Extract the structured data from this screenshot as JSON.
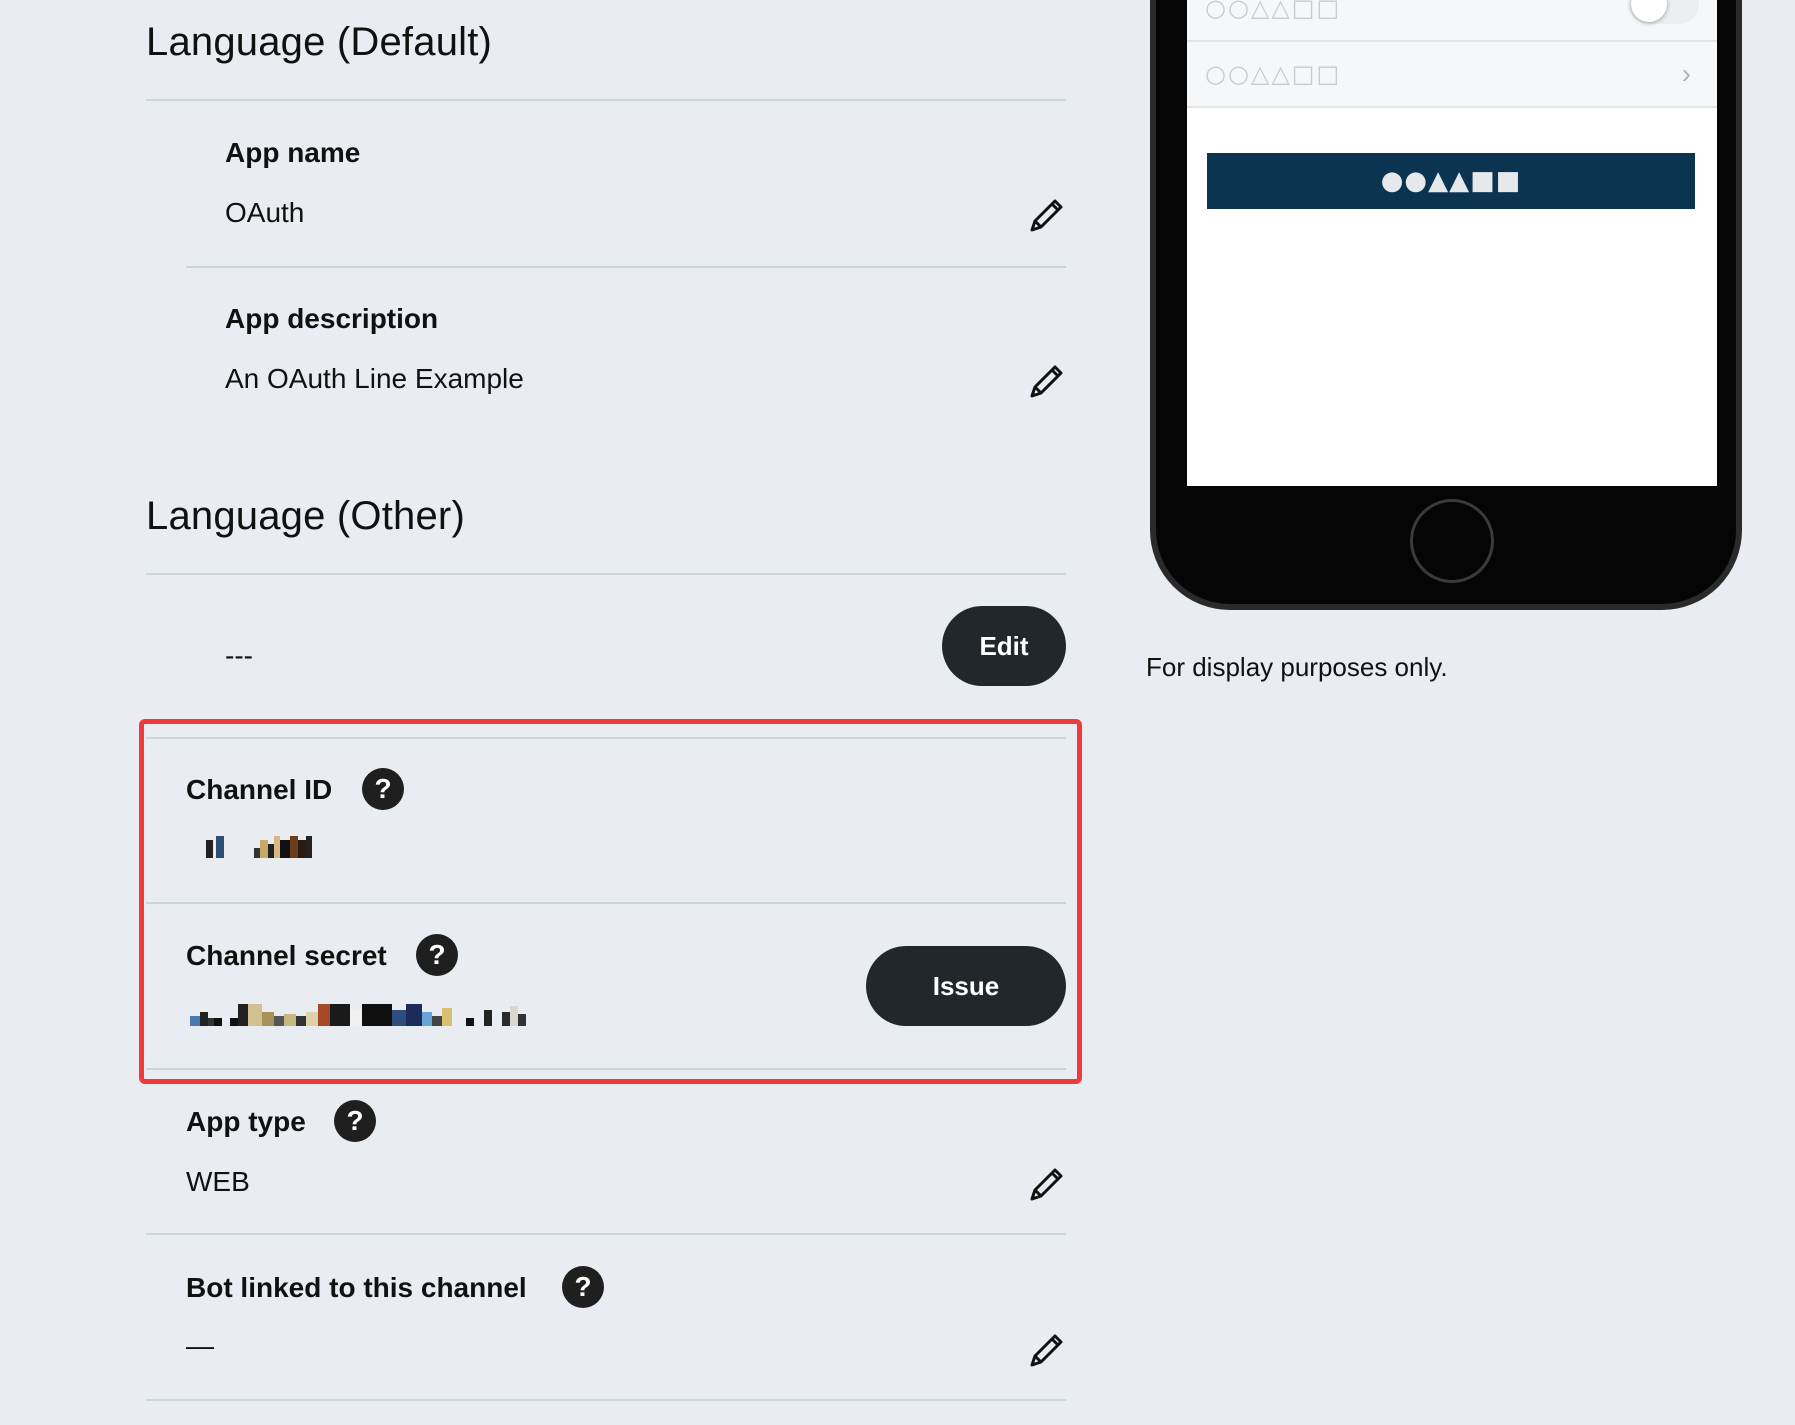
{
  "language_default": {
    "title": "Language (Default)",
    "app_name": {
      "label": "App name",
      "value": "OAuth"
    },
    "app_description": {
      "label": "App description",
      "value": "An OAuth Line Example"
    }
  },
  "language_other": {
    "title": "Language (Other)",
    "value": "---",
    "edit_label": "Edit"
  },
  "channel": {
    "id_label": "Channel ID",
    "secret_label": "Channel secret",
    "issue_label": "Issue",
    "help_glyph": "?"
  },
  "app_type": {
    "label": "App type",
    "value": "WEB"
  },
  "bot_linked": {
    "label": "Bot linked to this channel",
    "value": "—"
  },
  "preview": {
    "caption": "For display purposes only.",
    "row_placeholder": "○○△△□□",
    "chevron": "›",
    "button_placeholder": "●●▲▲■■"
  },
  "colors": {
    "background": "#e9edf1",
    "highlight_border": "#ef3b3b",
    "button_dark": "#22272b",
    "preview_button": "#0b3450"
  },
  "icons": [
    "pencil-icon",
    "help-icon",
    "chevron-right-icon",
    "toggle-switch",
    "home-button"
  ]
}
